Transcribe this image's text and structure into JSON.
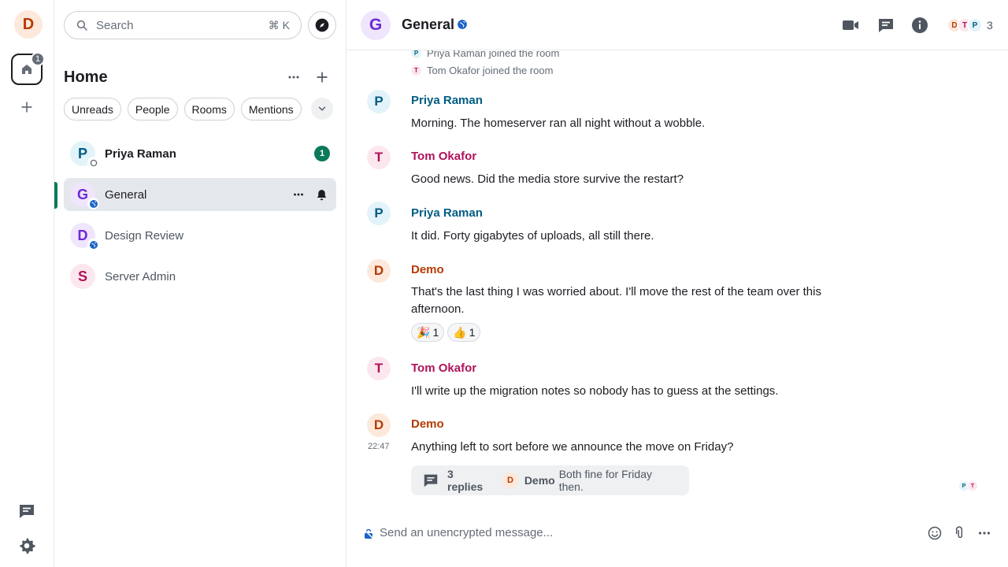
{
  "rail": {
    "user_initial": "D",
    "home_badge": "1"
  },
  "roomlist": {
    "search_placeholder": "Search",
    "search_shortcut": "⌘ K",
    "title": "Home",
    "filters": [
      "Unreads",
      "People",
      "Rooms",
      "Mentions"
    ],
    "rooms": [
      {
        "initial": "P",
        "name": "Priya Raman",
        "badge": "1",
        "avatar_bg": "#e2f3f9",
        "avatar_fg": "#005d82"
      },
      {
        "initial": "G",
        "name": "General",
        "avatar_bg": "#efe6fd",
        "avatar_fg": "#6b28d8"
      },
      {
        "initial": "D",
        "name": "Design Review",
        "avatar_bg": "#efe6fd",
        "avatar_fg": "#6b28d8"
      },
      {
        "initial": "S",
        "name": "Server Admin",
        "avatar_bg": "#fce7ef",
        "avatar_fg": "#b0125a"
      }
    ]
  },
  "header": {
    "room_initial": "G",
    "room_name": "General",
    "faces": [
      "D",
      "T",
      "P"
    ],
    "member_count": "3"
  },
  "timeline": {
    "joins": [
      {
        "initial": "P",
        "text": "Priya Raman joined the room"
      },
      {
        "initial": "T",
        "text": "Tom Okafor joined the room"
      }
    ],
    "messages": [
      {
        "initial": "P",
        "sender": "Priya Raman",
        "body": "Morning. The homeserver ran all night without a wobble."
      },
      {
        "initial": "T",
        "sender": "Tom Okafor",
        "body": "Good news. Did the media store survive the restart?"
      },
      {
        "initial": "P",
        "sender": "Priya Raman",
        "body": "It did. Forty gigabytes of uploads, all still there."
      },
      {
        "initial": "D",
        "sender": "Demo",
        "body": "That's the last thing I was worried about. I'll move the rest of the team over this afternoon."
      },
      {
        "initial": "T",
        "sender": "Tom Okafor",
        "body": "I'll write up the migration notes so nobody has to guess at the settings."
      },
      {
        "initial": "D",
        "sender": "Demo",
        "body": "Anything left to sort before we announce the move on Friday?",
        "time": "22:47"
      }
    ],
    "reactions": [
      {
        "emoji": "🎉",
        "count": "1"
      },
      {
        "emoji": "👍",
        "count": "1"
      }
    ],
    "thread": {
      "count_label": "3 replies",
      "author_initial": "D",
      "author": "Demo",
      "preview": "Both fine for Friday then."
    },
    "read_receipts": [
      "P",
      "T"
    ]
  },
  "composer": {
    "placeholder": "Send an unencrypted message..."
  },
  "colors": {
    "accent_green": "#0b7a5a",
    "priya": "#005d82",
    "tom": "#b0125a",
    "demo": "#b63a00"
  }
}
